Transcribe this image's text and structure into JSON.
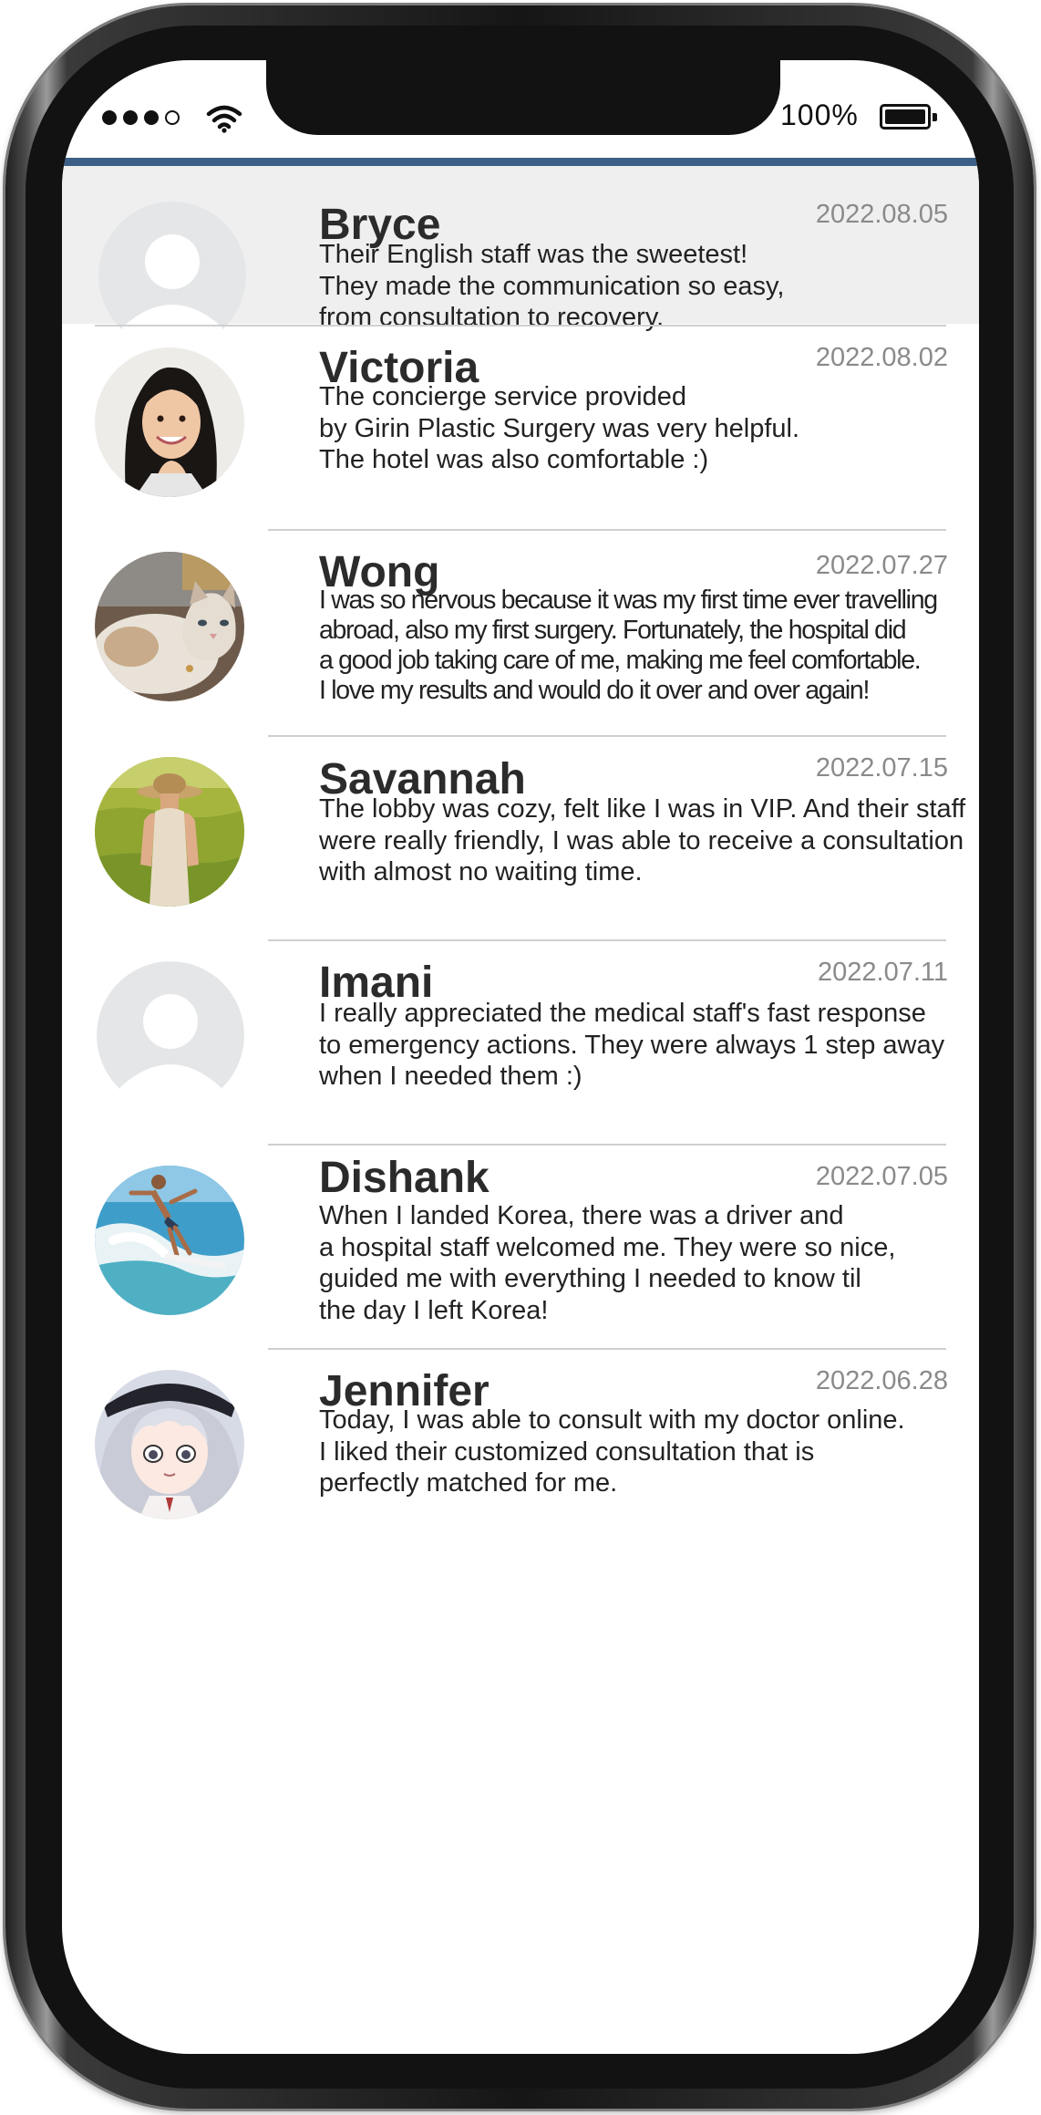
{
  "status_bar": {
    "signal_icon": "cellular-signal-dots",
    "wifi_icon": "wifi-icon",
    "battery_text": "100%",
    "battery_level": 1.0,
    "battery_icon": "battery-icon"
  },
  "colors": {
    "accent_rule": "#3b5f86",
    "highlight_row": "#efefef",
    "date_text": "#8a8a8a",
    "name_text": "#2b2b2b"
  },
  "reviews": [
    {
      "name": "Bryce",
      "date": "2022.08.05",
      "lines": [
        "Their English staff was the sweetest!",
        "They made the communication so easy,",
        "from consultation to recovery."
      ],
      "avatar": "default-user-avatar"
    },
    {
      "name": "Victoria",
      "date": "2022.08.02",
      "lines": [
        "The concierge service provided",
        "by Girin Plastic Surgery was very helpful.",
        "The hotel was also comfortable :)"
      ],
      "avatar": "woman-portrait-avatar"
    },
    {
      "name": "Wong",
      "date": "2022.07.27",
      "lines": [
        "I was so nervous because it was my first time ever travelling",
        "abroad, also my first surgery. Fortunately, the hospital did",
        "a good job taking care of me, making me feel comfortable.",
        "I love my results and would do it over and over again!"
      ],
      "avatar": "cat-avatar"
    },
    {
      "name": "Savannah",
      "date": "2022.07.15",
      "lines": [
        "The lobby was cozy, felt like I was in VIP. And their staff",
        "were really friendly, I was able to receive a consultation",
        "with almost no waiting time."
      ],
      "avatar": "woman-in-field-avatar"
    },
    {
      "name": "Imani",
      "date": "2022.07.11",
      "lines": [
        "I really appreciated the medical staff's fast response",
        "to emergency actions. They were always 1 step away",
        "when I needed them :)"
      ],
      "avatar": "default-user-avatar"
    },
    {
      "name": "Dishank",
      "date": "2022.07.05",
      "lines": [
        "When I landed Korea, there was a driver and",
        "a hospital staff welcomed me. They were so nice,",
        "guided me with everything I needed to know til",
        "the day I left Korea!"
      ],
      "avatar": "surfer-avatar"
    },
    {
      "name": "Jennifer",
      "date": "2022.06.28",
      "lines": [
        "Today, I was able to consult with my doctor online.",
        "I liked their customized consultation that is",
        "perfectly matched for me."
      ],
      "avatar": "anime-character-avatar"
    }
  ]
}
